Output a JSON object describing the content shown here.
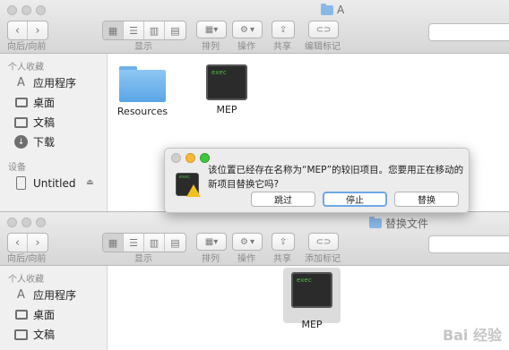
{
  "top_window": {
    "title": "A",
    "toolbar": {
      "back_forward_label": "向后/向前",
      "view_label": "显示",
      "arrange_label": "排列",
      "action_label": "操作",
      "share_label": "共享",
      "edit_tags_label": "编辑标记"
    },
    "sidebar": {
      "favorites_header": "个人收藏",
      "favorites": [
        "应用程序",
        "桌面",
        "文稿",
        "下载"
      ],
      "devices_header": "设备",
      "devices": [
        "Untitled"
      ]
    },
    "files": [
      {
        "name": "Resources",
        "kind": "folder"
      },
      {
        "name": "MEP",
        "kind": "executable",
        "icon_text": "exec"
      }
    ]
  },
  "dialog": {
    "message": "该位置已经存在名称为“MEP”的较旧项目。您要用正在移动的新项目替换它吗?",
    "buttons": {
      "skip": "跳过",
      "stop": "停止",
      "replace": "替换"
    },
    "icon_text": "exec"
  },
  "bottom_window": {
    "title": "替换文件",
    "toolbar": {
      "back_forward_label": "向后/向前",
      "view_label": "显示",
      "arrange_label": "排列",
      "action_label": "操作",
      "share_label": "共享",
      "add_tags_label": "添加标记"
    },
    "sidebar": {
      "favorites_header": "个人收藏",
      "favorites": [
        "应用程序",
        "桌面",
        "文稿"
      ]
    },
    "files": [
      {
        "name": "MEP",
        "kind": "executable",
        "icon_text": "exec",
        "selected": true
      }
    ]
  },
  "watermark": "Bai 经验",
  "colors": {
    "folder_blue": "#5aa5e6",
    "default_button_ring": "#6ea8e8",
    "terminal_green": "#49c43a"
  }
}
